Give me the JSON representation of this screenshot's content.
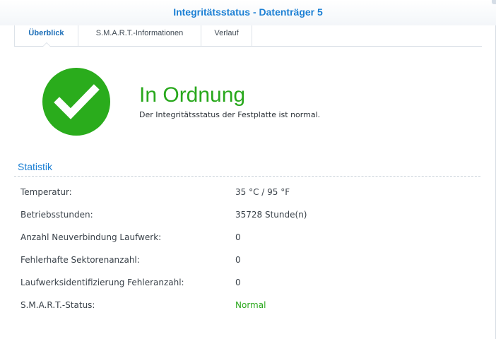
{
  "window": {
    "title": "Integritätsstatus - Datenträger 5"
  },
  "tabs": [
    {
      "label": "Überblick",
      "active": true
    },
    {
      "label": "S.M.A.R.T.-Informationen",
      "active": false
    },
    {
      "label": "Verlauf",
      "active": false
    }
  ],
  "health": {
    "icon": "checkmark-circle-icon",
    "headline": "In Ordnung",
    "description": "Der Integritätsstatus der Festplatte ist normal.",
    "color": "#2aac1c"
  },
  "statistics": {
    "title": "Statistik",
    "rows": [
      {
        "label": "Temperatur:",
        "value": "35 °C / 95 °F"
      },
      {
        "label": "Betriebsstunden:",
        "value": "35728 Stunde(n)"
      },
      {
        "label": "Anzahl Neuverbindung Laufwerk:",
        "value": "0"
      },
      {
        "label": "Fehlerhafte Sektorenanzahl:",
        "value": "0"
      },
      {
        "label": "Laufwerksidentifizierung Fehleranzahl:",
        "value": "0"
      },
      {
        "label": "S.M.A.R.T.-Status:",
        "value": "Normal"
      }
    ]
  },
  "colors": {
    "accent": "#1d80d4",
    "ok": "#2aa81c"
  }
}
